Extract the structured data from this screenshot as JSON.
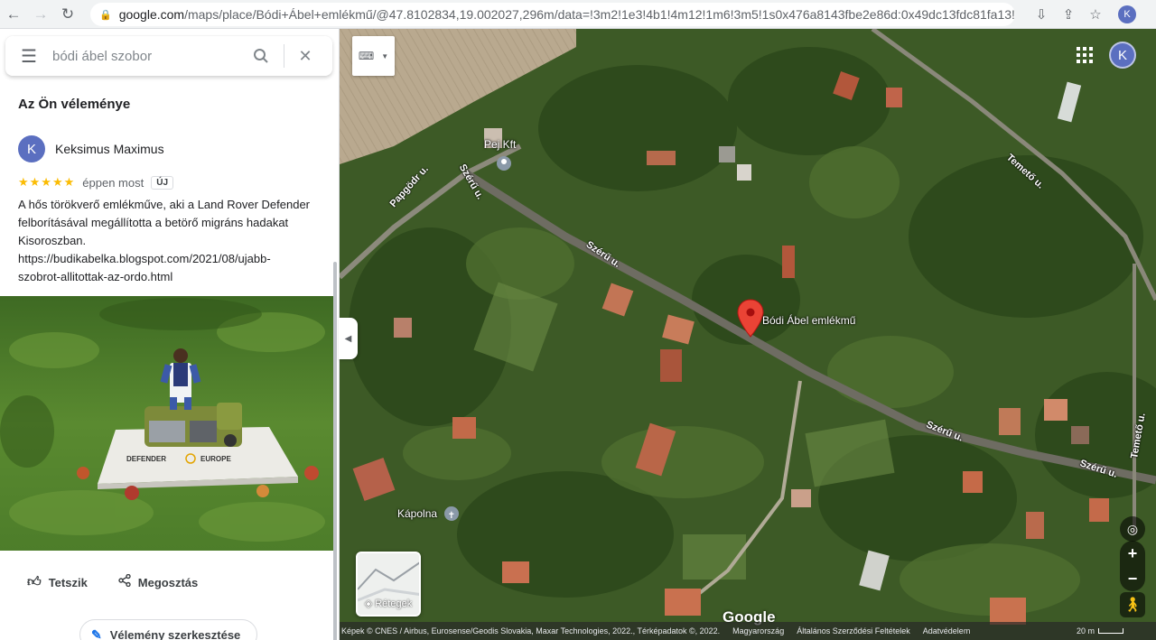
{
  "browser": {
    "url_host": "google.com",
    "url_path": "/maps/place/Bódi+Ábel+emlékmű/@47.8102834,19.002027,296m/data=!3m2!1e3!4b1!4m12!1m6!3m5!1s0x476a8143fbe2e86d:0x49dc13fdc81fa13!...",
    "profile_initial": "K"
  },
  "search": {
    "placeholder": "bódi ábel szobor"
  },
  "review": {
    "section_title": "Az Ön véleménye",
    "reviewer_initial": "K",
    "reviewer_name": "Keksimus Maximus",
    "stars": "★★★★★",
    "rating": 5,
    "time": "éppen most",
    "badge": "ÚJ",
    "text_line1": "A hős törökverő emlékműve, aki a Land Rover Defender",
    "text_line2": "felborításával megállította a betörő migráns hadakat",
    "text_line3": "Kisoroszban.",
    "text_line4": "https://budikabelka.blogspot.com/2021/08/ujabb-",
    "text_line5": "szobrot-allitottak-az-ordo.html",
    "photo_text_left": "DEFENDER",
    "photo_text_right": "EUROPE"
  },
  "actions": {
    "like": "Tetszik",
    "share": "Megosztás",
    "edit_review": "Vélemény szerkesztése"
  },
  "map": {
    "pin_label": "Bódi Ábel emlékmű",
    "poi_pej": "Pej Kft",
    "poi_kapolna": "Kápolna",
    "street_szeru": "Szérű u.",
    "street_papgodr": "Papgödr u.",
    "street_temeto": "Temető u.",
    "layers_label": "Rétegek",
    "google_logo": "Google",
    "avatar_initial": "K",
    "attribution_images": "Képek © CNES / Airbus, Eurosense/Geodis Slovakia, Maxar Technologies, 2022., Térképadatok ©, 2022.",
    "attribution_country": "Magyarország",
    "attribution_terms": "Általános Szerződési Feltételek",
    "attribution_privacy": "Adatvédelem",
    "scale": "20 m"
  },
  "colors": {
    "accent": "#1a73e8",
    "avatar": "#5b6fc0",
    "star": "#fbbc04",
    "pin": "#ea4335"
  }
}
